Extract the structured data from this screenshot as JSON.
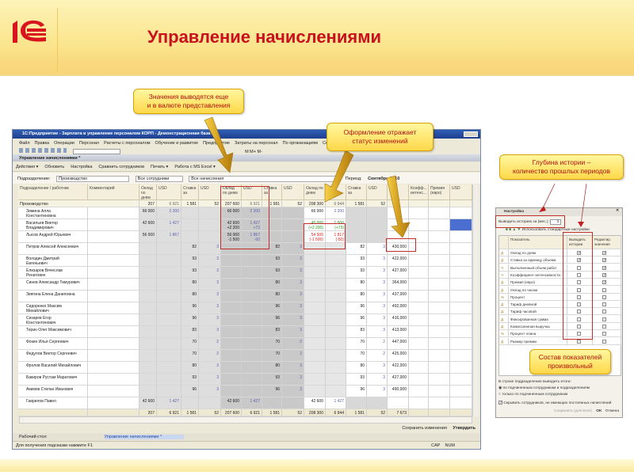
{
  "slide": {
    "title": "Управление начислениями",
    "logo_text": "1С"
  },
  "callouts": {
    "currency": "Значения выводятся еще\nи в валюте представления",
    "status": "Оформление отражает\nстатус изменений",
    "depth": "Глубина истории –\nколичество прошлых периодов",
    "composition": "Состав показателей\nпроизвольный"
  },
  "colors": {
    "accent": "#c8101e",
    "increase": "#1a9a1a",
    "decrease": "#e0201a",
    "selection": "#4a6fd0"
  },
  "window": {
    "title": "1С:Предприятие - Зарплата и управление персоналом КОРП - Демонстрационная база",
    "menu": [
      "Файл",
      "Правка",
      "Операции",
      "Персонал",
      "Расчеты с персоналом",
      "Обучение и развитие",
      "Предприятие",
      "Затраты на персонал",
      "По организациям",
      "Сервис",
      "Окна",
      "Справка"
    ],
    "toolbar_text": "М  М+  М-",
    "subwindow_title": "Управление начислениями *",
    "actions": [
      "Действия ▾",
      "Обновить",
      "Настройка",
      "Сравнить сотрудников",
      "Печать ▾",
      "Работа с MS Excel ▾"
    ],
    "filter": {
      "dept_label": "Подразделение:",
      "dept_value": "Производство",
      "employees": "Все сотрудники",
      "accruals": "Все начисления",
      "period_label": "Период:",
      "period_value": "Сентябрь 2010"
    },
    "columns": [
      "Подразделение / работник",
      "Комментарий",
      "Оклад по дням ...",
      "USD",
      "Ставка за",
      "USD",
      "Оклад по дням",
      "USD",
      "Ставка за",
      "USD",
      "Оклад по дням",
      "USD",
      "Ставка за",
      "USD",
      "",
      "Коэфф... интенс...",
      "Премия (евро)",
      "USD"
    ],
    "group": {
      "name": "Производство",
      "cells": [
        "",
        "",
        "207 600",
        "6 921",
        "1 581",
        "52",
        "207 600",
        "6 921",
        "1 581",
        "52",
        "208 300",
        "6 944",
        "1 581",
        "52",
        "",
        "",
        "",
        ""
      ]
    },
    "rows": [
      {
        "name": "Зимина Алла\nКонстантиновна",
        "status": "",
        "cells": [
          "66 000",
          "2 200",
          "",
          "",
          "66 000",
          "2 200",
          "",
          "",
          "66 000",
          "2 200",
          "",
          "",
          "",
          "",
          "",
          ""
        ]
      },
      {
        "name": "Васильев Виктор\nВладимирович",
        "status": "up",
        "cells": [
          "42 600",
          "1 427",
          "",
          "",
          "42 600\n+2 200",
          "1 427\n+73",
          "",
          "",
          "45 000\n(+2 200)",
          "1 500\n(+73)",
          "",
          "",
          "",
          "",
          "",
          ""
        ]
      },
      {
        "name": "Лысов Андрей Юрьевич",
        "status": "down",
        "cells": [
          "56 000",
          "1 867",
          "",
          "",
          "56 000\n-1 500",
          "1 867\n-50",
          "",
          "",
          "54 500\n(-1 500)",
          "1 817\n(-50)",
          "",
          "",
          "",
          "",
          "",
          ""
        ]
      },
      {
        "name": "Петров Алексей Алексеевич",
        "status": "",
        "cells": [
          "",
          "",
          "82",
          "3",
          "",
          "",
          "82",
          "3",
          "",
          "",
          "82",
          "3",
          "430,000",
          "",
          "",
          ""
        ]
      },
      {
        "name": "Володин Дмитрий\nЕвгеньевич",
        "status": "",
        "cells": [
          "",
          "",
          "93",
          "3",
          "",
          "",
          "93",
          "3",
          "",
          "",
          "93",
          "3",
          "422,000",
          "",
          "",
          ""
        ]
      },
      {
        "name": "Елизаров Вячеслав\nРенатович",
        "status": "",
        "cells": [
          "",
          "",
          "93",
          "3",
          "",
          "",
          "93",
          "3",
          "",
          "",
          "93",
          "3",
          "427,000",
          "",
          "",
          ""
        ]
      },
      {
        "name": "Синев Александр Тимурович",
        "status": "",
        "cells": [
          "",
          "",
          "80",
          "3",
          "",
          "",
          "80",
          "3",
          "",
          "",
          "80",
          "3",
          "364,000",
          "",
          "",
          ""
        ]
      },
      {
        "name": "Звягина Елена Даниловна",
        "status": "",
        "cells": [
          "",
          "",
          "80",
          "3",
          "",
          "",
          "80",
          "3",
          "",
          "",
          "80",
          "3",
          "437,000",
          "",
          "",
          ""
        ]
      },
      {
        "name": "Сидоренко Максим\nМихайлович",
        "status": "",
        "cells": [
          "",
          "",
          "96",
          "3",
          "",
          "",
          "96",
          "3",
          "",
          "",
          "96",
          "3",
          "492,000",
          "",
          "",
          ""
        ]
      },
      {
        "name": "Сизарев Егор\nКонстантинович",
        "status": "",
        "cells": [
          "",
          "",
          "96",
          "3",
          "",
          "",
          "96",
          "3",
          "",
          "",
          "96",
          "3",
          "416,000",
          "",
          "",
          ""
        ]
      },
      {
        "name": "Терин Олег Максимович",
        "status": "",
        "cells": [
          "",
          "",
          "83",
          "3",
          "",
          "",
          "83",
          "3",
          "",
          "",
          "83",
          "3",
          "413,000",
          "",
          "",
          ""
        ]
      },
      {
        "name": "Фокин Илья Сергеевич",
        "status": "",
        "cells": [
          "",
          "",
          "70",
          "2",
          "",
          "",
          "70",
          "2",
          "",
          "",
          "70",
          "2",
          "447,000",
          "",
          "",
          ""
        ]
      },
      {
        "name": "Федулов Виктор Сергеевич",
        "status": "",
        "cells": [
          "",
          "",
          "70",
          "2",
          "",
          "",
          "70",
          "2",
          "",
          "",
          "70",
          "2",
          "425,000",
          "",
          "",
          ""
        ]
      },
      {
        "name": "Фролов Василий Михайлович",
        "status": "",
        "cells": [
          "",
          "",
          "80",
          "3",
          "",
          "",
          "80",
          "3",
          "",
          "",
          "80",
          "3",
          "422,000",
          "",
          "",
          ""
        ]
      },
      {
        "name": "Бакиров Рустам Маратович",
        "status": "",
        "cells": [
          "",
          "",
          "93",
          "3",
          "",
          "",
          "93",
          "3",
          "",
          "",
          "93",
          "3",
          "427,000",
          "",
          "",
          ""
        ]
      },
      {
        "name": "Акимов Степан Иванович",
        "status": "",
        "cells": [
          "",
          "",
          "96",
          "3",
          "",
          "",
          "96",
          "3",
          "",
          "",
          "96",
          "3",
          "490,000",
          "",
          "",
          ""
        ]
      },
      {
        "name": "Гаврилов Павел",
        "status": "",
        "cells": [
          "42 600",
          "1 427",
          "",
          "",
          "42 600",
          "1 427",
          "",
          "",
          "42 600",
          "1 427",
          "",
          "",
          "",
          "",
          "",
          ""
        ]
      }
    ],
    "totals": [
      "",
      "",
      "207 600",
      "6 921",
      "1 581",
      "52",
      "207 600",
      "6 921",
      "1 581",
      "52",
      "208 300",
      "6 944",
      "1 581",
      "52",
      "7 673",
      "",
      "",
      ""
    ],
    "save_button": "Сохранить изменения",
    "approve_button": "Утвердить",
    "taskbar": [
      "Рабочий стол",
      "Управление начислениями *"
    ],
    "status_hint": "Для получения подсказки нажмите F1",
    "status_flags": [
      "CAP",
      "NUM"
    ]
  },
  "settings": {
    "title": "Настройка",
    "history_label": "Выводить историю за (мес.):",
    "history_value": "3",
    "standard_settings": "Использовать стандартные настройки",
    "columns": [
      "Показатель",
      "Выводить истории",
      "Редактир. значения"
    ],
    "items": [
      {
        "type": "Д",
        "name": "Оклад по дням",
        "history": true,
        "edit": true
      },
      {
        "type": "Д",
        "name": "Ставка за единицу объема",
        "history": true,
        "edit": true
      },
      {
        "type": "Ч",
        "name": "Выполненный объем работ",
        "history": false,
        "edit": true
      },
      {
        "type": "Ч",
        "name": "Коэффициент интенсивности",
        "history": false,
        "edit": true
      },
      {
        "type": "Д",
        "name": "Премия (евро)",
        "history": false,
        "edit": true
      },
      {
        "type": "Д",
        "name": "Оклад по часам",
        "history": false,
        "edit": false
      },
      {
        "type": "%",
        "name": "Процент",
        "history": false,
        "edit": false
      },
      {
        "type": "Д",
        "name": "Тариф дневной",
        "history": false,
        "edit": false
      },
      {
        "type": "Д",
        "name": "Тариф часовой",
        "history": false,
        "edit": false
      },
      {
        "type": "Д",
        "name": "Фиксированная сумма",
        "history": false,
        "edit": false
      },
      {
        "type": "Д",
        "name": "Комиссионная выручка",
        "history": false,
        "edit": false
      },
      {
        "type": "%",
        "name": "Процент плана",
        "history": false,
        "edit": false
      },
      {
        "type": "Д",
        "name": "Размер премии",
        "history": false,
        "edit": false
      }
    ],
    "totals_label": "В строке подразделения выводить итоги:",
    "radio_all": "по подчиненным сотрудникам и подразделениям",
    "radio_only": "только по подчиненным сотрудникам",
    "hide_label": "Скрывать сотрудников, не имеющих постоянных начислений",
    "hide_checked": true,
    "save_all": "Сохранить (для всех)",
    "ok": "OK",
    "cancel": "Отмена"
  }
}
